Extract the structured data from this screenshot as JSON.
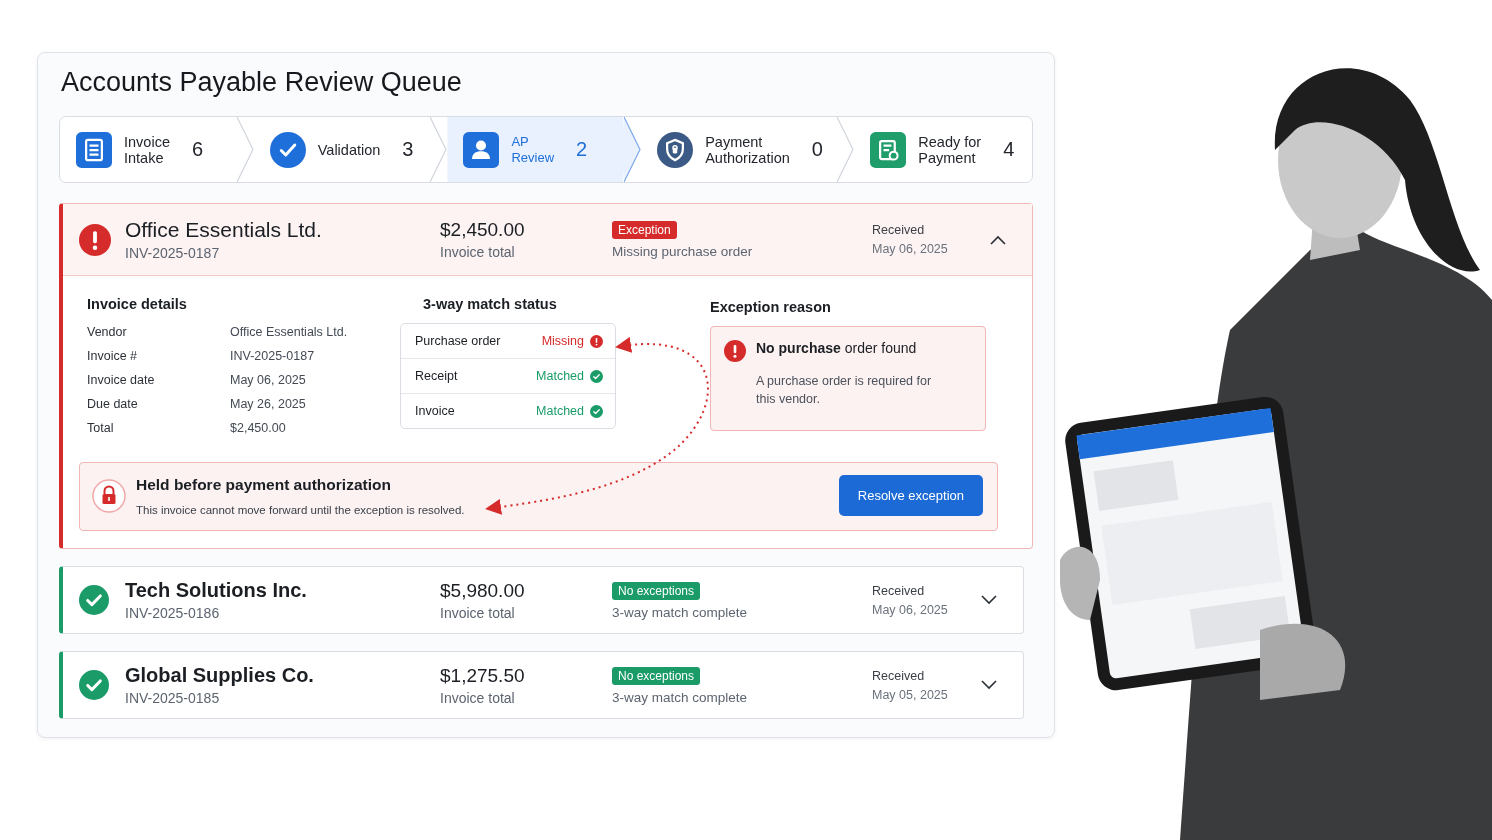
{
  "title": "Accounts Payable Review Queue",
  "steps": [
    {
      "label": "Invoice\nIntake",
      "count": "6",
      "kind": "document",
      "selected": false
    },
    {
      "label": "Validation",
      "count": "3",
      "kind": "check",
      "selected": false
    },
    {
      "label": "AP\nReview",
      "count": "2",
      "kind": "person",
      "selected": true
    },
    {
      "label": "Payment\nAuthorization",
      "count": "0",
      "kind": "shield",
      "selected": false
    },
    {
      "label": "Ready for\nPayment",
      "count": "4",
      "kind": "doc-check",
      "selected": false
    }
  ],
  "invoices": [
    {
      "kind": "exception",
      "vendor": "Office Essentials Ltd.",
      "number": "INV-2025-0187",
      "amount": "$2,450.00",
      "amount_label": "Invoice total",
      "badge": "Exception",
      "note": "Missing purchase order",
      "received_label": "Received",
      "received_date": "May 06, 2025",
      "expanded": true,
      "details": {
        "title": "Invoice details",
        "rows": [
          {
            "label": "Vendor",
            "value": "Office Essentials Ltd."
          },
          {
            "label": "Invoice #",
            "value": "INV-2025-0187"
          },
          {
            "label": "Invoice date",
            "value": "May 06, 2025"
          },
          {
            "label": "Due date",
            "value": "May 26, 2025"
          },
          {
            "label": "Total",
            "value": "$2,450.00"
          }
        ],
        "match_title": "3-way match status",
        "match": [
          {
            "label": "Purchase order",
            "status": "Missing",
            "kind": "missing"
          },
          {
            "label": "Receipt",
            "status": "Matched",
            "kind": "matched"
          },
          {
            "label": "Invoice",
            "status": "Matched",
            "kind": "matched"
          }
        ],
        "exception_title": "Exception reason",
        "exception_heading": "**No purchase** order found",
        "exception_text": "A purchase order is required for this vendor.",
        "hold_title": "Held before payment authorization",
        "hold_text": "This invoice cannot move forward until the exception is resolved.",
        "action": "Resolve exception"
      }
    },
    {
      "kind": "ok",
      "vendor": "Tech Solutions Inc.",
      "number": "INV-2025-0186",
      "amount": "$5,980.00",
      "amount_label": "Invoice total",
      "badge": "No exceptions",
      "note": "3-way match complete",
      "received_label": "Received",
      "received_date": "May 06, 2025",
      "expanded": false
    },
    {
      "kind": "ok",
      "vendor": "Global Supplies Co.",
      "number": "INV-2025-0185",
      "amount": "$1,275.50",
      "amount_label": "Invoice total",
      "badge": "No exceptions",
      "note": "3-way match complete",
      "received_label": "Received",
      "received_date": "May 05, 2025",
      "expanded": false
    }
  ]
}
